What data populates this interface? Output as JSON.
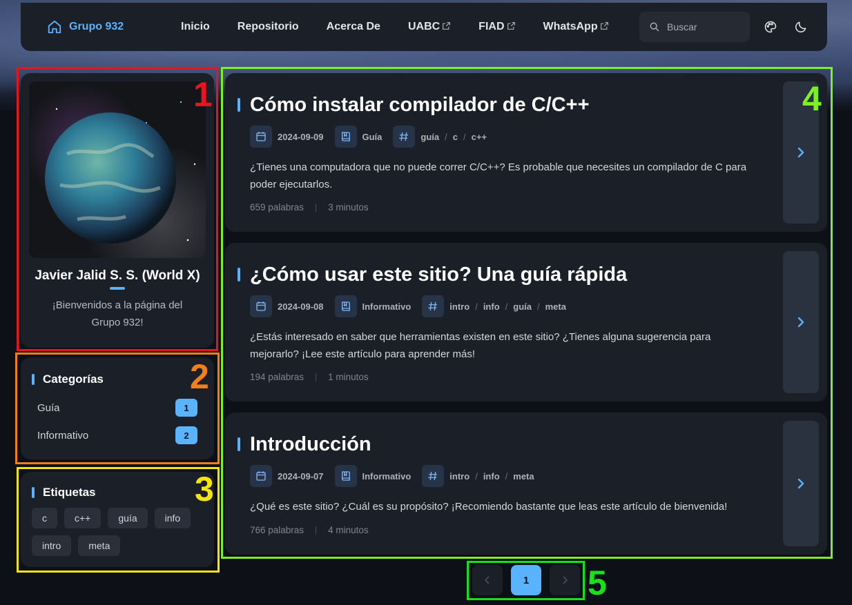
{
  "navbar": {
    "brand": "Grupo 932",
    "links": [
      {
        "label": "Inicio",
        "external": false
      },
      {
        "label": "Repositorio",
        "external": false
      },
      {
        "label": "Acerca De",
        "external": false
      },
      {
        "label": "UABC",
        "external": true
      },
      {
        "label": "FIAD",
        "external": true
      },
      {
        "label": "WhatsApp",
        "external": true
      }
    ],
    "search_placeholder": "Buscar"
  },
  "profile": {
    "name": "Javier Jalid S. S. (World X)",
    "description": "¡Bienvenidos a la página del Grupo 932!"
  },
  "categories": {
    "title": "Categorías",
    "items": [
      {
        "label": "Guía",
        "count": "1"
      },
      {
        "label": "Informativo",
        "count": "2"
      }
    ]
  },
  "tags": {
    "title": "Etiquetas",
    "items": [
      "c",
      "c++",
      "guía",
      "info",
      "intro",
      "meta"
    ]
  },
  "posts": [
    {
      "title": "Cómo instalar compilador de C/C++",
      "date": "2024-09-09",
      "category": "Guía",
      "tags": [
        "guía",
        "c",
        "c++"
      ],
      "excerpt": "¿Tienes una computadora que no puede correr C/C++? Es probable que necesites un compilador de C para poder ejecutarlos.",
      "words": "659 palabras",
      "time": "3 minutos"
    },
    {
      "title": "¿Cómo usar este sitio? Una guía rápida",
      "date": "2024-09-08",
      "category": "Informativo",
      "tags": [
        "intro",
        "info",
        "guía",
        "meta"
      ],
      "excerpt": "¿Estás interesado en saber que herramientas existen en este sitio? ¿Tienes alguna sugerencia para mejorarlo? ¡Lee este artículo para aprender más!",
      "words": "194 palabras",
      "time": "1 minutos"
    },
    {
      "title": "Introducción",
      "date": "2024-09-07",
      "category": "Informativo",
      "tags": [
        "intro",
        "info",
        "meta"
      ],
      "excerpt": "¿Qué es este sitio? ¿Cuál es su propósito? ¡Recomiendo bastante que leas este artículo de bienvenida!",
      "words": "766 palabras",
      "time": "4 minutos"
    }
  ],
  "pagination": {
    "current": "1"
  },
  "annotations": [
    {
      "label": "1",
      "color": "#e8141e"
    },
    {
      "label": "2",
      "color": "#f57f17"
    },
    {
      "label": "3",
      "color": "#f5e50f"
    },
    {
      "label": "4",
      "color": "#7cf021"
    },
    {
      "label": "5",
      "color": "#18e01c"
    }
  ],
  "colors": {
    "accent": "#5ab3ff",
    "background": "#0d1117",
    "card": "#1b1f27"
  }
}
